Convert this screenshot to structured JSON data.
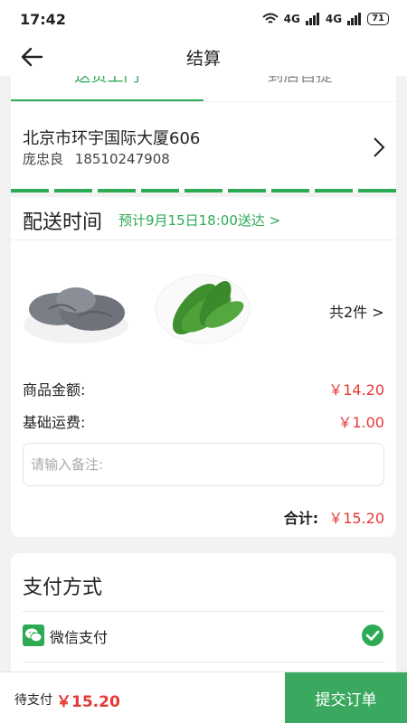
{
  "status_bar": {
    "time": "17:42",
    "network": "4G",
    "battery": "71"
  },
  "nav": {
    "title": "结算"
  },
  "tabs": [
    {
      "label": "送货上门"
    },
    {
      "label": "到店自提"
    }
  ],
  "address": {
    "line": "北京市环宇国际大厦606",
    "name": "庞忠良",
    "phone": "18510247908"
  },
  "delivery": {
    "label": "配送时间",
    "estimate": "预计9月15日18:00送达 >"
  },
  "products": [
    {
      "icon": "oyster-mushroom-image"
    },
    {
      "icon": "cucumber-image"
    }
  ],
  "order": {
    "count_label": "共2件 >",
    "goods_label": "商品金额:",
    "goods_amount": "￥14.20",
    "shipping_label": "基础运费:",
    "shipping_amount": "￥1.00",
    "note_placeholder": "请输入备注:",
    "total_label": "合计:",
    "total_amount": "￥15.20"
  },
  "payment": {
    "title": "支付方式",
    "method": "微信支付"
  },
  "footer": {
    "pending_label": "待支付",
    "pending_amount": "￥15.20",
    "submit_label": "提交订单"
  },
  "colors": {
    "accent": "#2eaa55",
    "price": "#e53935",
    "submit": "#3aa85f"
  }
}
